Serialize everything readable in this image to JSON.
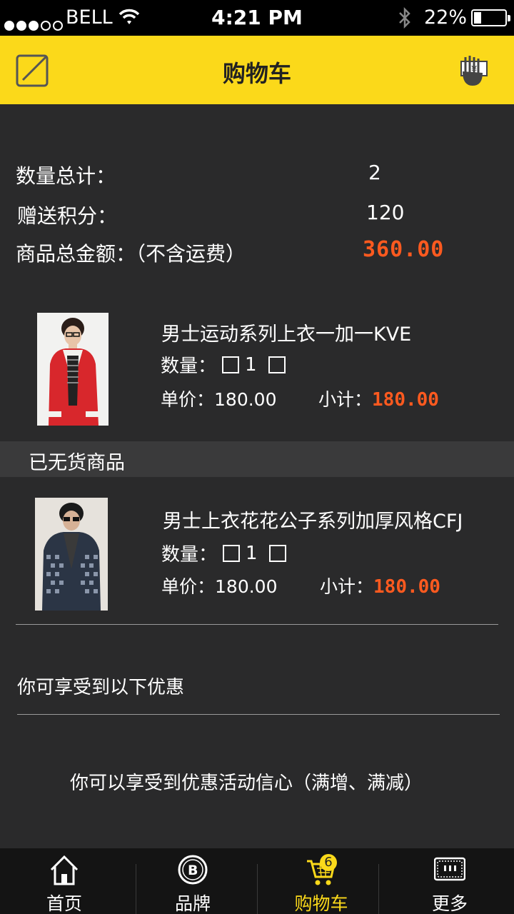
{
  "status_bar": {
    "carrier": "BELL",
    "time": "4:21 PM",
    "battery": "22%"
  },
  "header": {
    "title": "购物车",
    "edit_icon": "edit-icon",
    "pay_icon": "hand-yuan-icon"
  },
  "summary": {
    "quantity_label": "数量总计：",
    "quantity_value": "2",
    "points_label": "赠送积分：",
    "points_value": "120",
    "total_label": "商品总金额：（不含运费）",
    "total_value": "360.00"
  },
  "products": [
    {
      "name": "男士运动系列上衣一加一KVE",
      "qty_label": "数量：",
      "qty": "1",
      "unit_label": "单价：",
      "unit_price": "180.00",
      "subtotal_label": "小计：",
      "subtotal": "180.00"
    },
    {
      "name": "男士上衣花花公子系列加厚风格CFJ",
      "qty_label": "数量：",
      "qty": "1",
      "unit_label": "单价：",
      "unit_price": "180.00",
      "subtotal_label": "小计：",
      "subtotal": "180.00"
    }
  ],
  "out_of_stock_label": "已无货商品",
  "promo": {
    "title": "你可享受到以下优惠",
    "text": "你可以享受到优惠活动信心（满增、满减）"
  },
  "tabbar": {
    "tabs": [
      {
        "label": "首页",
        "icon": "home-icon"
      },
      {
        "label": "品牌",
        "icon": "brand-icon"
      },
      {
        "label": "购物车",
        "icon": "cart-icon",
        "badge": "6"
      },
      {
        "label": "更多",
        "icon": "more-icon"
      }
    ],
    "active_index": 2
  },
  "colors": {
    "accent": "#fbd91a",
    "price": "#ff5a1f",
    "background": "#2a2a2b"
  }
}
